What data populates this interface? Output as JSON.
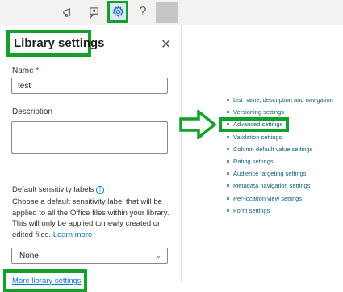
{
  "topbar": {
    "icons": [
      "megaphone-icon",
      "feedback-icon",
      "gear-icon",
      "help-icon"
    ],
    "help_glyph": "?"
  },
  "panel": {
    "title": "Library settings",
    "close_glyph": "✕",
    "name_label": "Name",
    "name_required_marker": "*",
    "name_value": "test",
    "description_label": "Description",
    "description_value": "",
    "sensitivity_label": "Default sensitivity labels",
    "sensitivity_help": "Choose a default sensitivity label that will be applied to all the Office files within your library. This will only be applied to newly created or edited files.",
    "learn_more": "Learn more",
    "sensitivity_selected": "None",
    "more_settings_link": "More library settings"
  },
  "settings_list": [
    "List name, description and navigation",
    "Versioning settings",
    "Advanced settings",
    "Validation settings",
    "Column default value settings",
    "Rating settings",
    "Audience targeting settings",
    "Metadata navigation settings",
    "Per-location view settings",
    "Form settings"
  ],
  "colors": {
    "highlight": "#12a12b",
    "link": "#0078d4"
  }
}
